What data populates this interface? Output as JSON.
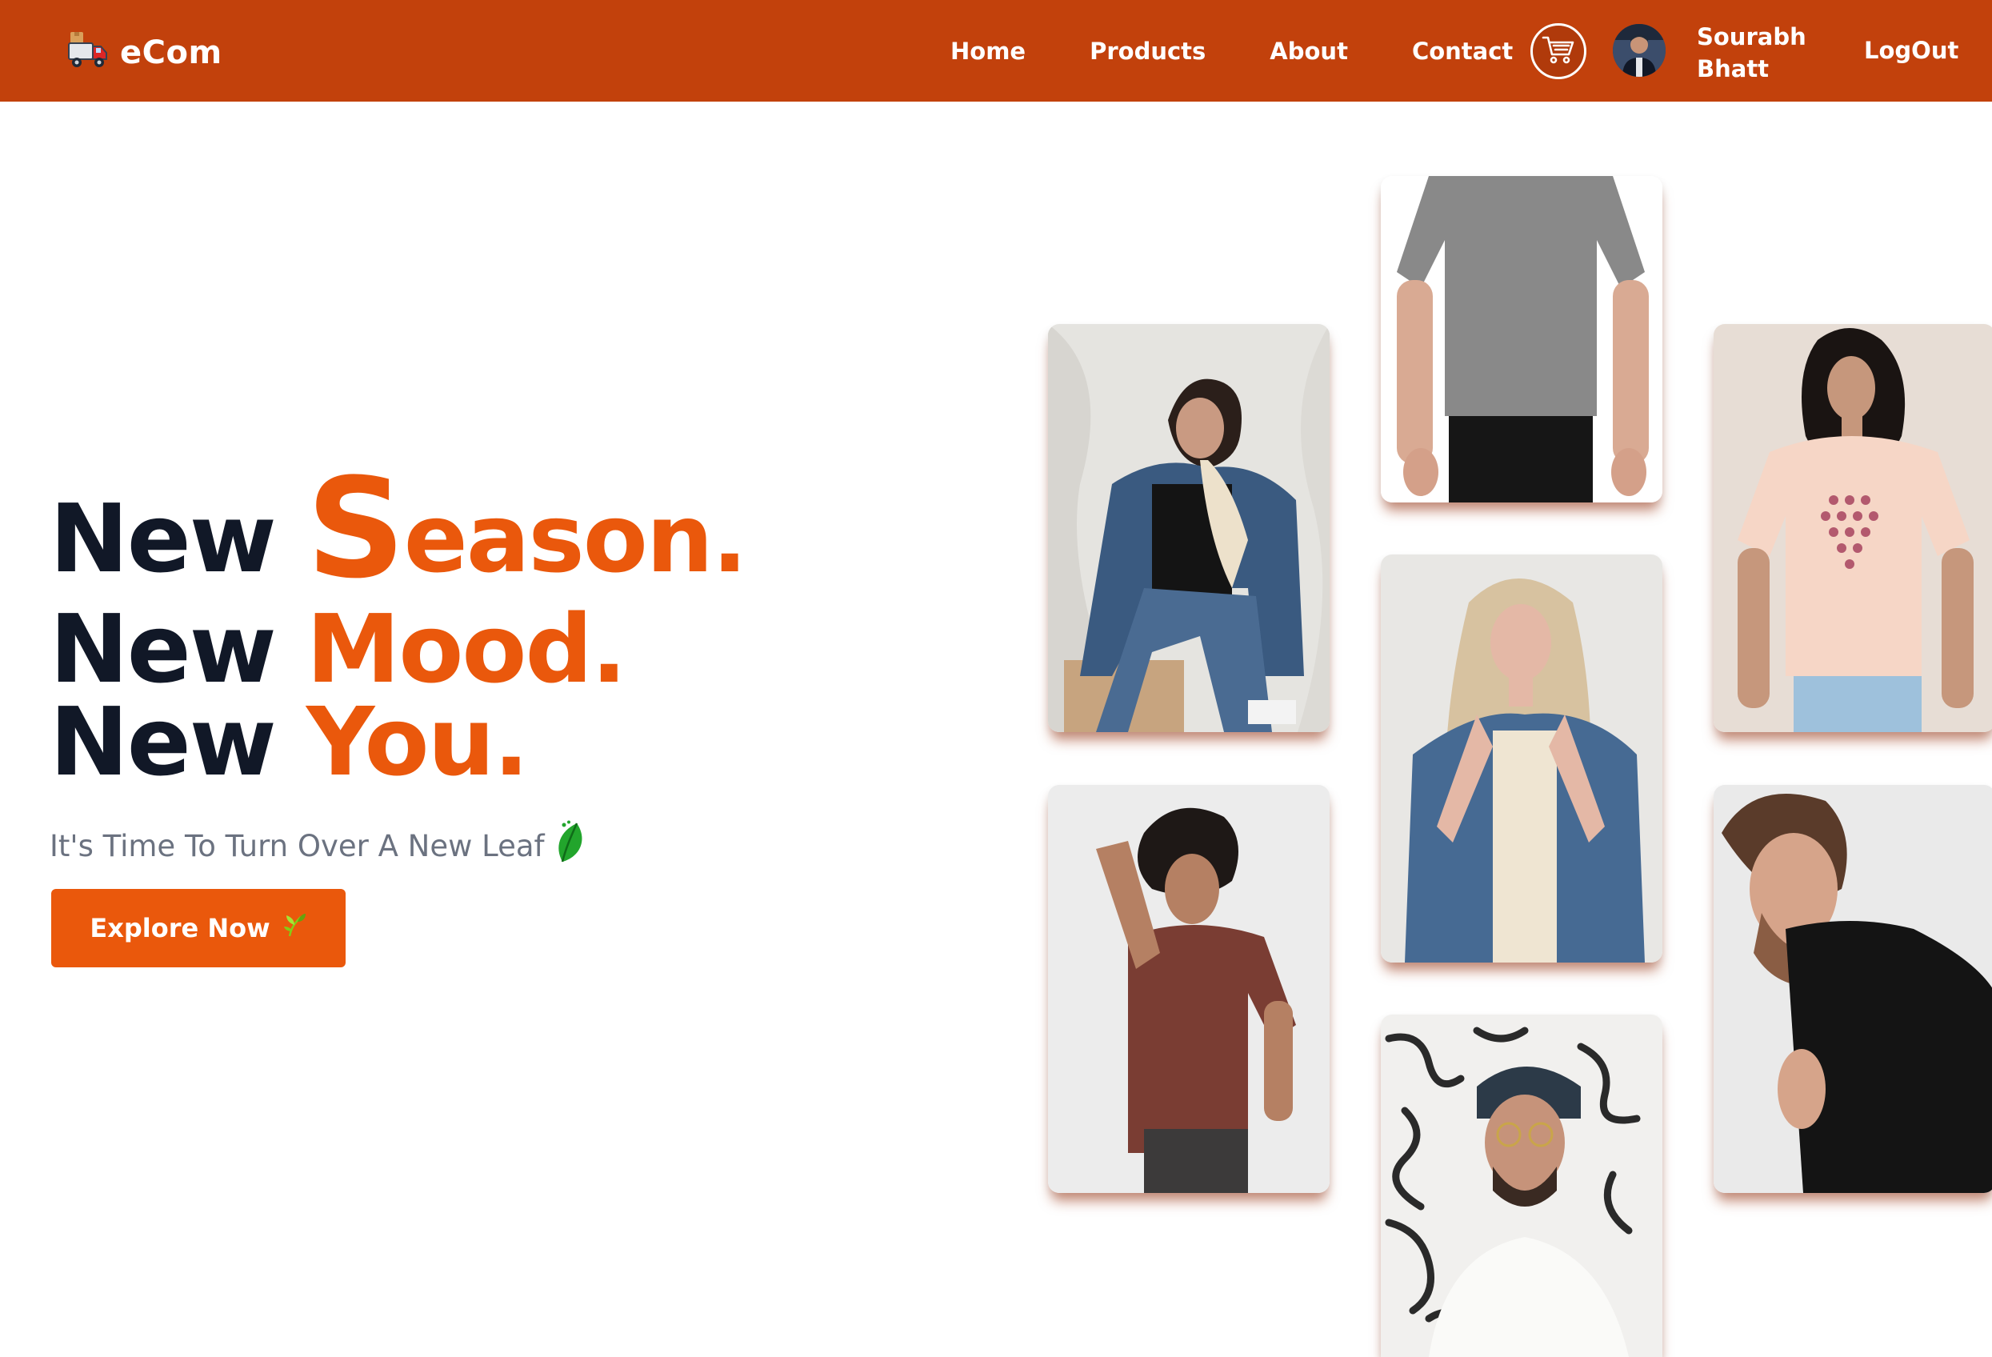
{
  "brand": {
    "name": "eCom",
    "icon": "delivery-truck-icon"
  },
  "nav": {
    "links": [
      "Home",
      "Products",
      "About",
      "Contact"
    ]
  },
  "cart": {
    "icon": "shopping-cart-icon"
  },
  "user": {
    "first_name": "Sourabh",
    "last_name": "Bhatt"
  },
  "logout_label": "LogOut",
  "hero": {
    "line1_word": "New",
    "line1_accent_initial": "S",
    "line1_accent_rest": "eason.",
    "line2_word": "New",
    "line2_accent": "Mood.",
    "line3_word": "New",
    "line3_accent": "You.",
    "subtitle": "It's Time To Turn Over A New Leaf",
    "subtitle_icon": "leaf-icon",
    "cta_label": "Explore Now",
    "cta_icon": "sprout-icon"
  },
  "gallery": [
    {
      "name": "woman-denim-jacket-black-tee"
    },
    {
      "name": "grey-tee-torso"
    },
    {
      "name": "woman-peach-dotted-tee"
    },
    {
      "name": "man-brown-tee"
    },
    {
      "name": "woman-denim-jacket-cream-tee"
    },
    {
      "name": "man-black-tee"
    },
    {
      "name": "man-beanie-white-tee"
    }
  ],
  "colors": {
    "navbar": "#c2410c",
    "accent": "#ea580c",
    "heading": "#111827",
    "subtitle": "#6b7280"
  }
}
